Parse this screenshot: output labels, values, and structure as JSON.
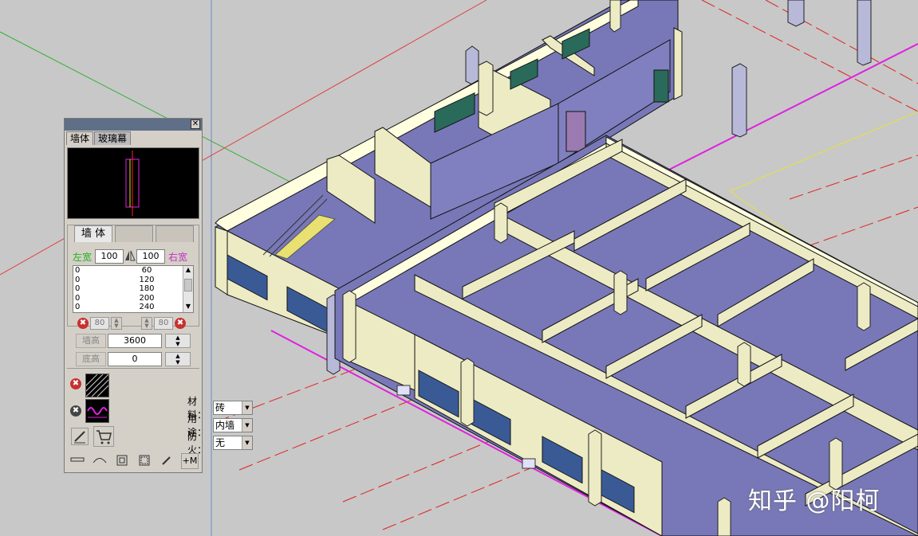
{
  "panel": {
    "tabs": [
      "墙体",
      "玻璃幕"
    ],
    "subtabs": [
      "墙 体",
      "",
      ""
    ],
    "left_width_label": "左宽",
    "right_width_label": "右宽",
    "left_width": "100",
    "right_width": "100",
    "width_list": [
      {
        "left": "0",
        "right": "60"
      },
      {
        "left": "0",
        "right": "120"
      },
      {
        "left": "0",
        "right": "180"
      },
      {
        "left": "0",
        "right": "200"
      },
      {
        "left": "0",
        "right": "240"
      }
    ],
    "offset_left": "80",
    "offset_right": "80",
    "wall_height_label": "墙高",
    "wall_height": "3600",
    "base_height_label": "底高",
    "base_height": "0",
    "material_label": "材料：",
    "material_value": "砖",
    "usage_label": "用途：",
    "usage_value": "内墙",
    "fire_label": "防火：",
    "fire_value": "无",
    "bottom_tool_text": "+M",
    "close_glyph": "✕",
    "delete_glyph": "✖"
  },
  "watermark": "知乎 @阳柯",
  "colors": {
    "viewport_bg": "#c8c8c8",
    "wall_face": "#ecebc4",
    "wall_top": "#ffffe0",
    "floor": "#7878b8",
    "window": "#3a5a96",
    "accent_magenta": "#e020e0",
    "axis_red": "#ff2020"
  },
  "icons": [
    "close-icon",
    "delete-icon",
    "mirror-icon",
    "spin-icon",
    "hatch-icon",
    "wave-icon",
    "edit-icon",
    "cart-icon",
    "wall-tool-icon",
    "arc-icon",
    "window-icon",
    "room-icon",
    "eyedropper-icon"
  ]
}
